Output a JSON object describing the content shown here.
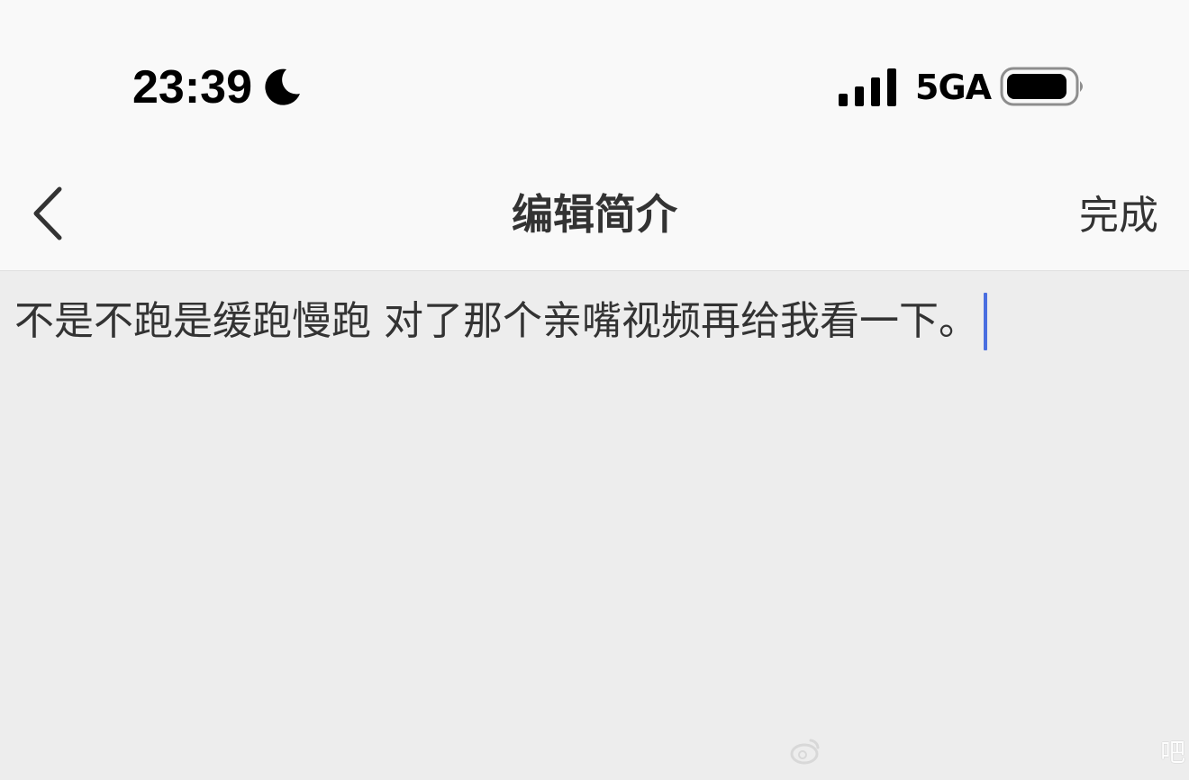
{
  "status_bar": {
    "time": "23:39",
    "network": "5GA",
    "icons": [
      "moon-icon",
      "signal-icon",
      "battery-icon"
    ]
  },
  "nav": {
    "back_icon": "chevron-left-icon",
    "title": "编辑简介",
    "done_label": "完成"
  },
  "editor": {
    "value": "不是不跑是缓跑慢跑 对了那个亲嘴视频再给我看一下。",
    "caret_color": "#4a6ee0"
  },
  "watermark": {
    "text": "吧"
  },
  "colors": {
    "background": "#ededed",
    "bar_background": "#f9f9f9",
    "text": "#333333"
  }
}
